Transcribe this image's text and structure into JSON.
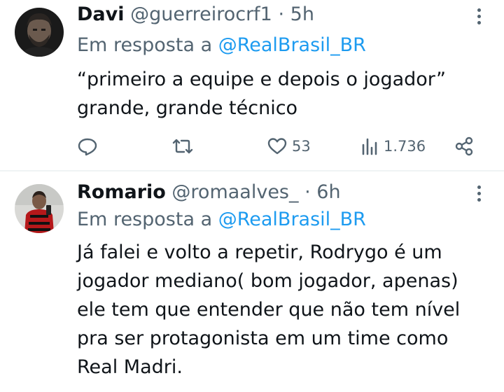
{
  "tweets": [
    {
      "name": "Davi",
      "handle": "@guerreirocrf1",
      "separator": "·",
      "time": "5h",
      "reply_prefix": "Em resposta a",
      "reply_mention": "@RealBrasil_BR",
      "text": "“primeiro a equipe e depois o jogador”\ngrande, grande técnico",
      "actions": {
        "reply_icon": "reply-icon",
        "retweet_icon": "retweet-icon",
        "like_icon": "heart-icon",
        "likes": "53",
        "views_icon": "views-icon",
        "views": "1.736",
        "share_icon": "share-icon"
      }
    },
    {
      "name": "Romario",
      "handle": "@romaalves_",
      "separator": "·",
      "time": "6h",
      "reply_prefix": "Em resposta a",
      "reply_mention": "@RealBrasil_BR",
      "text": "Já falei e volto a repetir, Rodrygo é um\njogador mediano( bom jogador, apenas)\nele tem que entender que não tem nível\npra ser protagonista em um time como\nReal Madri."
    }
  ],
  "colors": {
    "text": "#0f1419",
    "secondary": "#536471",
    "link": "#1d9bf0",
    "divider": "#eff3f4"
  }
}
